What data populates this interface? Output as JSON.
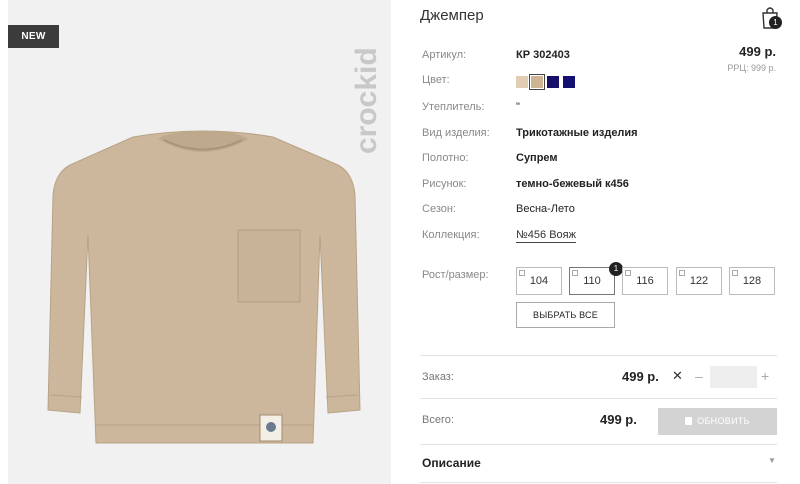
{
  "photo": {
    "badge": "NEW",
    "brand": "crockid"
  },
  "product": {
    "title": "Джемпер",
    "price": "499 р.",
    "rrp": "РРЦ: 999 р."
  },
  "cart": {
    "count": "1",
    "icon": "shopping-bag-icon"
  },
  "specs": [
    {
      "label": "Артикул:",
      "value": "КР 302403"
    },
    {
      "label": "Цвет:",
      "value": ""
    },
    {
      "label": "Утеплитель:",
      "value": "\""
    },
    {
      "label": "Вид изделия:",
      "value": "Трикотажные изделия"
    },
    {
      "label": "Полотно:",
      "value": "Супрем"
    },
    {
      "label": "Рисунок:",
      "value": "темно-бежевый к456"
    },
    {
      "label": "Сезон:",
      "value": "Весна-Лето"
    },
    {
      "label": "Коллекция:",
      "value": "№456 Вояж"
    }
  ],
  "swatches": [
    "#e0cdb4",
    "#cdb593",
    "#16106b",
    "#141073"
  ],
  "sizes": {
    "label": "Рост/размер:",
    "items": [
      "104",
      "110",
      "116",
      "122",
      "128"
    ],
    "selected_count": "1",
    "select_all": "ВЫБРАТЬ ВСЕ"
  },
  "order": {
    "label": "Заказ:",
    "price": "499 р.",
    "remove": "✕",
    "minus": "–",
    "plus": "+"
  },
  "total": {
    "label": "Всего:",
    "price": "499 р.",
    "button": "ОБНОВИТЬ"
  },
  "description": {
    "label": "Описание",
    "arrow": "▼"
  },
  "colors": {
    "accent_dark": "#222222",
    "button_disabled": "#d3d3d3"
  }
}
